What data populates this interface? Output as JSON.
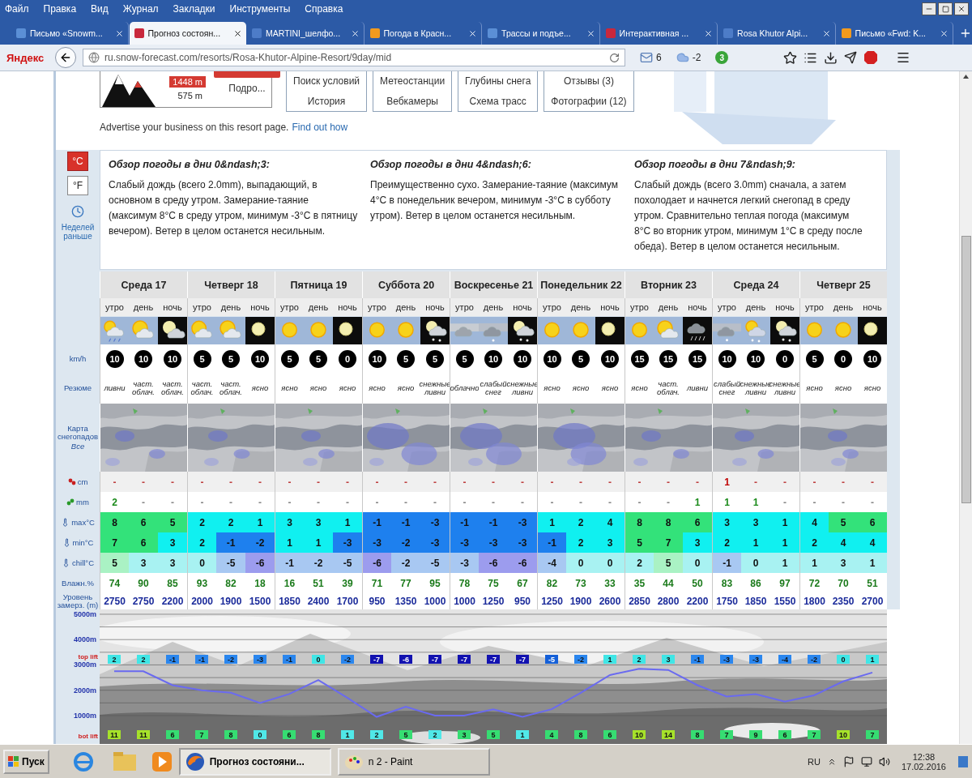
{
  "browser": {
    "menu": [
      "Файл",
      "Правка",
      "Вид",
      "Журнал",
      "Закладки",
      "Инструменты",
      "Справка"
    ],
    "tabs": [
      {
        "title": "Письмо «Snowm...",
        "selected": false
      },
      {
        "title": "Прогноз состоян...",
        "selected": true
      },
      {
        "title": "MARTINI_шелфо...",
        "selected": false
      },
      {
        "title": "Погода в Красн...",
        "selected": false
      },
      {
        "title": "Трассы и подъе...",
        "selected": false
      },
      {
        "title": "Интерактивная ...",
        "selected": false
      },
      {
        "title": "Rosa Khutor Alpi...",
        "selected": false
      },
      {
        "title": "Письмо «Fwd: K...",
        "selected": false
      }
    ],
    "brand": "Яндекс",
    "url": "ru.snow-forecast.com/resorts/Rosa-Khutor-Alpine-Resort/9day/mid",
    "mail_count": "6",
    "weather_temp": "-2",
    "badge_count": "3"
  },
  "resort": {
    "top_elevation": "1448 m",
    "bottom_elevation": "575 m",
    "more": "Подро...",
    "links": [
      [
        "Поиск условий",
        "История"
      ],
      [
        "Метеостанции",
        "Вебкамеры"
      ],
      [
        "Глубины снега",
        "Схема трасс"
      ],
      [
        "Отзывы (3)",
        "Фотографии (12)"
      ]
    ]
  },
  "advert": {
    "text": "Advertise your business on this resort page.",
    "link": "Find out how"
  },
  "units": [
    {
      "label": "°C",
      "selected": true
    },
    {
      "label": "°F",
      "selected": false
    }
  ],
  "earlier_link": "Неделей раньше",
  "overview": [
    {
      "title": "Обзор погоды в дни 0&ndash;3:",
      "text": "Слабый дождь (всего 2.0mm), выпадающий, в основном в среду утром. Замерание-таяние (максимум 8°C в среду утром, минимум -3°C в пятницу вечером). Ветер в целом останется несильным."
    },
    {
      "title": "Обзор погоды в дни 4&ndash;6:",
      "text": "Преимущественно сухо. Замерание-таяние (максимум 4°C в понедельник вечером, минимум -3°C в субботу утром). Ветер в целом останется несильным."
    },
    {
      "title": "Обзор погоды в дни 7&ndash;9:",
      "text": "Слабый дождь (всего 3.0mm) сначала, а затем похолодает и начнется легкий снегопад в среду утром. Сравнительно теплая погода (максимум 8°C во вторник утром, минимум 1°C в среду после обеда). Ветер в целом останется несильным."
    }
  ],
  "row_labels": {
    "wind": "km/h",
    "summary": "Резюме",
    "map": "Карта снегопадов",
    "map_link": "Все",
    "snow": "cm",
    "rain": "mm",
    "max": "max°C",
    "min": "min°C",
    "chill": "chill°C",
    "humidity": "Влажн.%",
    "freezing": "Уровень замерз. (m)"
  },
  "days": [
    {
      "name": "Среда 17",
      "periods": [
        {
          "name": "утро",
          "kind": "sun-cloud-rain",
          "wind": "10",
          "summary": "ливни",
          "snow": "-",
          "rain": "2",
          "max": "8",
          "min": "7",
          "chill": "5",
          "humidity": "74",
          "freezing": "2750",
          "top_lift": "2",
          "bot_lift": "11"
        },
        {
          "name": "день",
          "kind": "sun-cloud",
          "wind": "10",
          "summary": "част. облач.",
          "snow": "-",
          "rain": "-",
          "max": "6",
          "min": "6",
          "chill": "3",
          "humidity": "90",
          "freezing": "2750",
          "top_lift": "2",
          "bot_lift": "11"
        },
        {
          "name": "ночь",
          "kind": "moon-cloud",
          "wind": "10",
          "summary": "част. облач.",
          "snow": "-",
          "rain": "-",
          "max": "5",
          "min": "3",
          "chill": "3",
          "humidity": "85",
          "freezing": "2200",
          "top_lift": "-1",
          "bot_lift": "6"
        }
      ]
    },
    {
      "name": "Четверг 18",
      "periods": [
        {
          "name": "утро",
          "kind": "sun-cloud",
          "wind": "5",
          "summary": "част. облач.",
          "snow": "-",
          "rain": "-",
          "max": "2",
          "min": "2",
          "chill": "0",
          "humidity": "93",
          "freezing": "2000",
          "top_lift": "-1",
          "bot_lift": "7"
        },
        {
          "name": "день",
          "kind": "sun-cloud",
          "wind": "5",
          "summary": "част. облач.",
          "snow": "-",
          "rain": "-",
          "max": "2",
          "min": "-1",
          "chill": "-5",
          "humidity": "82",
          "freezing": "1900",
          "top_lift": "-2",
          "bot_lift": "8"
        },
        {
          "name": "ночь",
          "kind": "moon",
          "wind": "10",
          "summary": "ясно",
          "snow": "-",
          "rain": "-",
          "max": "1",
          "min": "-2",
          "chill": "-6",
          "humidity": "18",
          "freezing": "1500",
          "top_lift": "-3",
          "bot_lift": "0"
        }
      ]
    },
    {
      "name": "Пятница 19",
      "periods": [
        {
          "name": "утро",
          "kind": "sun",
          "wind": "5",
          "summary": "ясно",
          "snow": "-",
          "rain": "-",
          "max": "3",
          "min": "1",
          "chill": "-1",
          "humidity": "16",
          "freezing": "1850",
          "top_lift": "-1",
          "bot_lift": "6"
        },
        {
          "name": "день",
          "kind": "sun",
          "wind": "5",
          "summary": "ясно",
          "snow": "-",
          "rain": "-",
          "max": "3",
          "min": "1",
          "chill": "-2",
          "humidity": "51",
          "freezing": "2400",
          "top_lift": "0",
          "bot_lift": "8"
        },
        {
          "name": "ночь",
          "kind": "moon",
          "wind": "0",
          "summary": "ясно",
          "snow": "-",
          "rain": "-",
          "max": "1",
          "min": "-3",
          "chill": "-5",
          "humidity": "39",
          "freezing": "1700",
          "top_lift": "-2",
          "bot_lift": "1"
        }
      ]
    },
    {
      "name": "Суббота 20",
      "periods": [
        {
          "name": "утро",
          "kind": "sun",
          "wind": "10",
          "summary": "ясно",
          "snow": "-",
          "rain": "-",
          "max": "-1",
          "min": "-3",
          "chill": "-6",
          "humidity": "71",
          "freezing": "950",
          "top_lift": "-7",
          "bot_lift": "2"
        },
        {
          "name": "день",
          "kind": "sun",
          "wind": "5",
          "summary": "ясно",
          "snow": "-",
          "rain": "-",
          "max": "-1",
          "min": "-2",
          "chill": "-2",
          "humidity": "77",
          "freezing": "1350",
          "top_lift": "-6",
          "bot_lift": "5"
        },
        {
          "name": "ночь",
          "kind": "moon-snow",
          "wind": "5",
          "summary": "снежные ливни",
          "snow": "-",
          "rain": "-",
          "max": "-3",
          "min": "-3",
          "chill": "-5",
          "humidity": "95",
          "freezing": "1000",
          "top_lift": "-7",
          "bot_lift": "2"
        }
      ]
    },
    {
      "name": "Воскресенье 21",
      "periods": [
        {
          "name": "утро",
          "kind": "cloud",
          "wind": "5",
          "summary": "облачно",
          "snow": "-",
          "rain": "-",
          "max": "-1",
          "min": "-3",
          "chill": "-3",
          "humidity": "78",
          "freezing": "1000",
          "top_lift": "-7",
          "bot_lift": "3"
        },
        {
          "name": "день",
          "kind": "cloud-snow",
          "wind": "10",
          "summary": "слабый снег",
          "snow": "-",
          "rain": "-",
          "max": "-1",
          "min": "-3",
          "chill": "-6",
          "humidity": "75",
          "freezing": "1250",
          "top_lift": "-7",
          "bot_lift": "5"
        },
        {
          "name": "ночь",
          "kind": "moon-snow",
          "wind": "10",
          "summary": "снежные ливни",
          "snow": "-",
          "rain": "-",
          "max": "-3",
          "min": "-3",
          "chill": "-6",
          "humidity": "67",
          "freezing": "950",
          "top_lift": "-7",
          "bot_lift": "1"
        }
      ]
    },
    {
      "name": "Понедельник 22",
      "periods": [
        {
          "name": "утро",
          "kind": "sun",
          "wind": "10",
          "summary": "ясно",
          "snow": "-",
          "rain": "-",
          "max": "1",
          "min": "-1",
          "chill": "-4",
          "humidity": "82",
          "freezing": "1250",
          "top_lift": "-5",
          "bot_lift": "4"
        },
        {
          "name": "день",
          "kind": "sun",
          "wind": "5",
          "summary": "ясно",
          "snow": "-",
          "rain": "-",
          "max": "2",
          "min": "2",
          "chill": "0",
          "humidity": "73",
          "freezing": "1900",
          "top_lift": "-2",
          "bot_lift": "8"
        },
        {
          "name": "ночь",
          "kind": "moon",
          "wind": "10",
          "summary": "ясно",
          "snow": "-",
          "rain": "-",
          "max": "4",
          "min": "3",
          "chill": "0",
          "humidity": "33",
          "freezing": "2600",
          "top_lift": "1",
          "bot_lift": "6"
        }
      ]
    },
    {
      "name": "Вторник 23",
      "periods": [
        {
          "name": "утро",
          "kind": "sun",
          "wind": "15",
          "summary": "ясно",
          "snow": "-",
          "rain": "-",
          "max": "8",
          "min": "5",
          "chill": "2",
          "humidity": "35",
          "freezing": "2850",
          "top_lift": "2",
          "bot_lift": "10"
        },
        {
          "name": "день",
          "kind": "sun-cloud",
          "wind": "15",
          "summary": "част. облач.",
          "snow": "-",
          "rain": "-",
          "max": "8",
          "min": "7",
          "chill": "5",
          "humidity": "44",
          "freezing": "2800",
          "top_lift": "3",
          "bot_lift": "14"
        },
        {
          "name": "ночь",
          "kind": "night-rain",
          "wind": "15",
          "summary": "ливни",
          "snow": "-",
          "rain": "1",
          "max": "6",
          "min": "3",
          "chill": "0",
          "humidity": "50",
          "freezing": "2200",
          "top_lift": "-1",
          "bot_lift": "8"
        }
      ]
    },
    {
      "name": "Среда 24",
      "periods": [
        {
          "name": "утро",
          "kind": "cloud-snow",
          "wind": "10",
          "summary": "слабый снег",
          "snow": "1",
          "rain": "1",
          "max": "3",
          "min": "2",
          "chill": "-1",
          "humidity": "83",
          "freezing": "1750",
          "top_lift": "-3",
          "bot_lift": "7"
        },
        {
          "name": "день",
          "kind": "sun-cloud-snow",
          "wind": "10",
          "summary": "снежные ливни",
          "snow": "-",
          "rain": "1",
          "max": "3",
          "min": "1",
          "chill": "0",
          "humidity": "86",
          "freezing": "1850",
          "top_lift": "-3",
          "bot_lift": "9"
        },
        {
          "name": "ночь",
          "kind": "moon-snow",
          "wind": "0",
          "summary": "снежные ливни",
          "snow": "-",
          "rain": "-",
          "max": "1",
          "min": "1",
          "chill": "1",
          "humidity": "97",
          "freezing": "1550",
          "top_lift": "-4",
          "bot_lift": "6"
        }
      ]
    },
    {
      "name": "Четверг 25",
      "periods": [
        {
          "name": "утро",
          "kind": "sun",
          "wind": "5",
          "summary": "ясно",
          "snow": "-",
          "rain": "-",
          "max": "4",
          "min": "2",
          "chill": "1",
          "humidity": "72",
          "freezing": "1800",
          "top_lift": "-2",
          "bot_lift": "7"
        },
        {
          "name": "день",
          "kind": "sun",
          "wind": "0",
          "summary": "ясно",
          "snow": "-",
          "rain": "-",
          "max": "5",
          "min": "4",
          "chill": "3",
          "humidity": "70",
          "freezing": "2350",
          "top_lift": "0",
          "bot_lift": "10"
        },
        {
          "name": "ночь",
          "kind": "moon",
          "wind": "10",
          "summary": "ясно",
          "snow": "-",
          "rain": "-",
          "max": "6",
          "min": "4",
          "chill": "1",
          "humidity": "51",
          "freezing": "2700",
          "top_lift": "1",
          "bot_lift": "7"
        }
      ]
    }
  ],
  "chart": {
    "top_label": "top lift",
    "bottom_label": "bot lift",
    "chart_data": {
      "type": "line",
      "grid": true,
      "ylim": [
        -120,
        5190
      ],
      "yticks": [
        {
          "value": 1000,
          "label": "1000m"
        },
        {
          "value": 2000,
          "label": "2000m"
        },
        {
          "value": 3000,
          "label": "3000m"
        },
        {
          "value": 4000,
          "label": "4000m"
        },
        {
          "value": 5000,
          "label": "5000m"
        }
      ],
      "series": [
        {
          "color": "#6a6af0",
          "values": [
            2750,
            2750,
            2200,
            2000,
            1900,
            1500,
            1850,
            2400,
            1700,
            950,
            1350,
            1000,
            1000,
            1250,
            950,
            1250,
            1900,
            2600,
            2850,
            2800,
            2200,
            1750,
            1850,
            1550,
            1800,
            2350,
            2700
          ]
        }
      ]
    }
  },
  "taskbar": {
    "start": "Пуск",
    "tasks": [
      {
        "title": "Прогноз состояни...",
        "selected": true,
        "kind": "browser"
      },
      {
        "title": "n 2 - Paint",
        "selected": false,
        "kind": "paint"
      }
    ],
    "language": "RU",
    "time": "12:38",
    "date": "17.02.2016"
  }
}
